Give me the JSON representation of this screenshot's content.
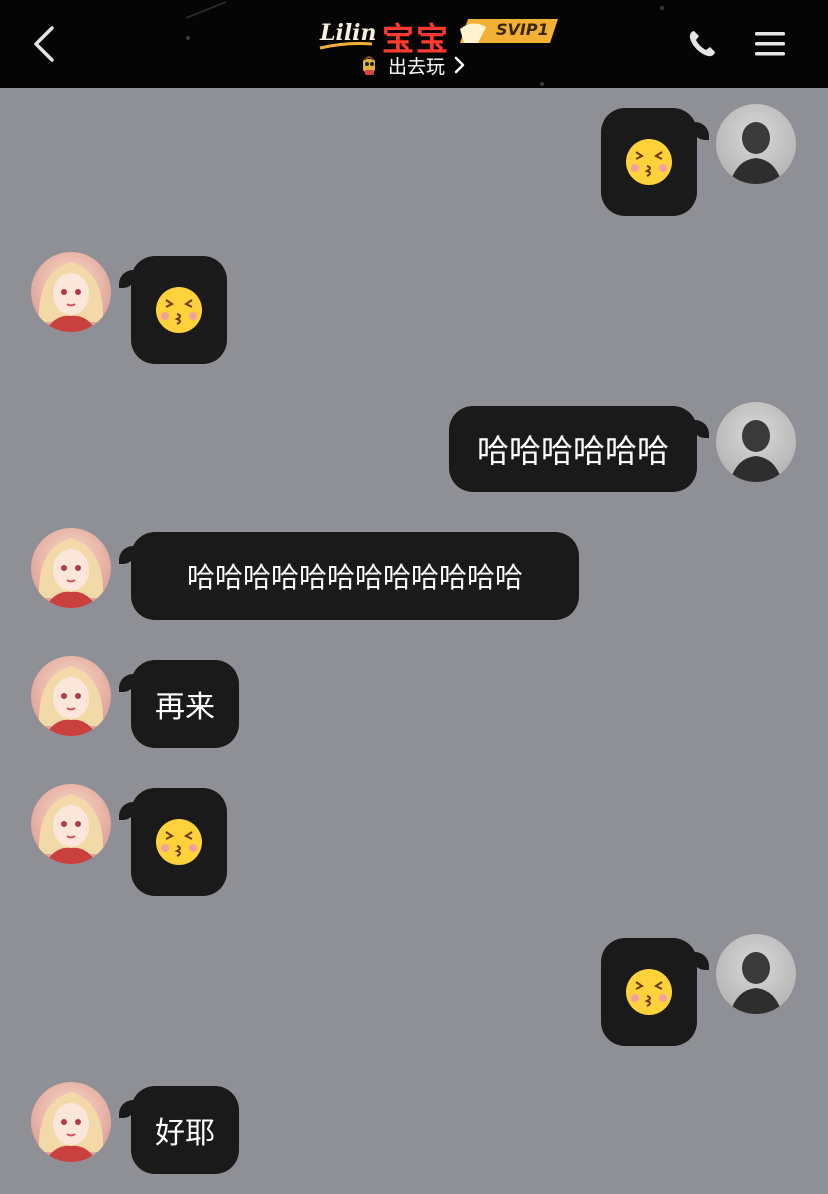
{
  "header": {
    "brand_logo_text": "Lilin",
    "contact_name": "宝宝",
    "vip_badge": "SVIP1",
    "status_text": "出去玩",
    "colors": {
      "name": "#ff3b30",
      "vip": "#f2b134",
      "bar": "#050505"
    }
  },
  "chat": {
    "background": "#8f9096",
    "messages": [
      {
        "sender": "me",
        "type": "emoji",
        "emoji": "kiss-face"
      },
      {
        "sender": "her",
        "type": "emoji",
        "emoji": "kiss-face"
      },
      {
        "sender": "me",
        "type": "text",
        "text": "哈哈哈哈哈哈"
      },
      {
        "sender": "her",
        "type": "text",
        "text": "哈哈哈哈哈哈哈哈哈哈哈哈"
      },
      {
        "sender": "her",
        "type": "text",
        "text": "再来"
      },
      {
        "sender": "her",
        "type": "emoji",
        "emoji": "kiss-face"
      },
      {
        "sender": "me",
        "type": "emoji",
        "emoji": "kiss-face"
      },
      {
        "sender": "her",
        "type": "text",
        "text": "好耶"
      }
    ]
  }
}
